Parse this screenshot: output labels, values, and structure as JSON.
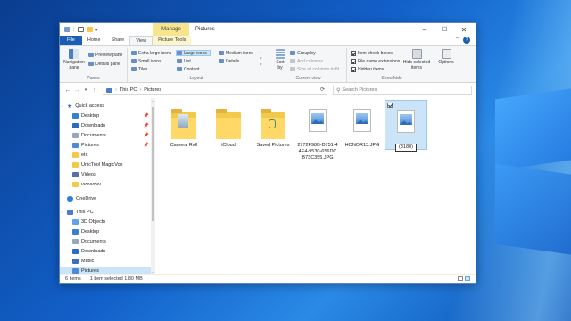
{
  "window": {
    "title": "Pictures",
    "context_tab": "Manage"
  },
  "ribbon_tabs": [
    "File",
    "Home",
    "Share",
    "View",
    "Picture Tools"
  ],
  "ribbon": {
    "panes": {
      "label": "Panes",
      "navigation_pane": "Navigation pane",
      "preview_pane": "Preview pane",
      "details_pane": "Details pane"
    },
    "layout": {
      "label": "Layout",
      "items": [
        "Extra large icons",
        "Large icons",
        "Medium icons",
        "Small icons",
        "List",
        "Details",
        "Tiles",
        "Content"
      ],
      "selected": "Large icons"
    },
    "current_view": {
      "label": "Current view",
      "sort_by": "Sort by",
      "group_by": "Group by",
      "add_columns": "Add columns",
      "size_columns": "Size all columns to fit"
    },
    "show_hide": {
      "label": "Show/hide",
      "item_check_boxes": "Item check boxes",
      "file_name_extensions": "File name extensions",
      "hidden_items": "Hidden items",
      "hide_selected": "Hide selected items",
      "options": "Options"
    }
  },
  "address": {
    "path": [
      "This PC",
      "Pictures"
    ],
    "search_placeholder": "Search Pictures"
  },
  "nav": {
    "quick_access": "Quick access",
    "items": [
      {
        "label": "Desktop",
        "pinned": true
      },
      {
        "label": "Downloads",
        "pinned": true
      },
      {
        "label": "Documents",
        "pinned": true
      },
      {
        "label": "Pictures",
        "pinned": true
      },
      {
        "label": "etc",
        "pinned": false
      },
      {
        "label": "UnicTool MagicVox",
        "pinned": false
      },
      {
        "label": "Videos",
        "pinned": false
      },
      {
        "label": "vvvvvvvv",
        "pinned": false
      }
    ],
    "onedrive": "OneDrive",
    "this_pc": "This PC",
    "pc_items": [
      "3D Objects",
      "Desktop",
      "Documents",
      "Downloads",
      "Music",
      "Pictures"
    ]
  },
  "files": [
    {
      "name": "Camera Roll",
      "type": "folder"
    },
    {
      "name": "iCloud",
      "type": "folder"
    },
    {
      "name": "Saved Pictures",
      "type": "folder"
    },
    {
      "name": "2772F98B-D751-4 4E4-9530-656DC B73C355.JPG",
      "type": "image"
    },
    {
      "name": "HONOR13.JPG",
      "type": "image"
    },
    {
      "name": "(3180)",
      "type": "image"
    }
  ],
  "status": {
    "count": "6 items",
    "selected": "1 item selected  1.80 MB"
  },
  "colors": {
    "accent": "#1a5fb4",
    "selection": "#cce4f7",
    "folder": "#ffd867"
  }
}
